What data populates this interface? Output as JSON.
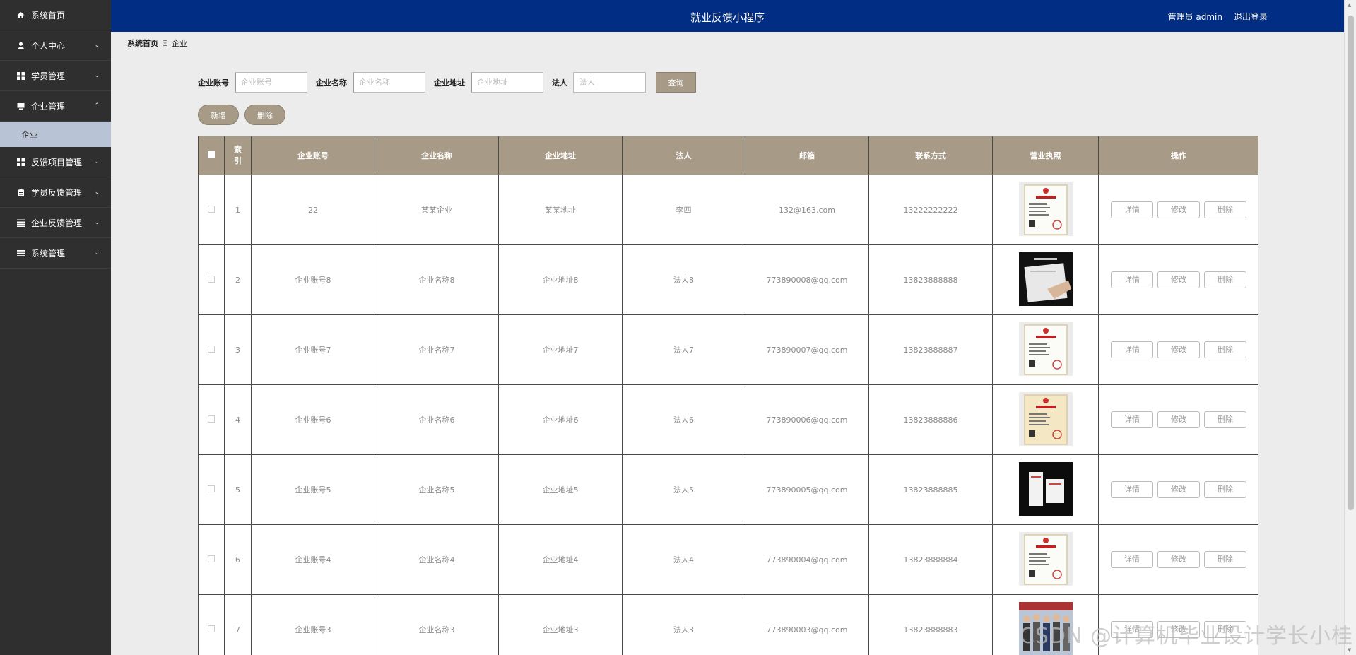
{
  "sidebar": {
    "items": [
      {
        "label": "系统首页",
        "icon": "home-icon",
        "chevron": ""
      },
      {
        "label": "个人中心",
        "icon": "user-icon",
        "chevron": "⌄"
      },
      {
        "label": "学员管理",
        "icon": "grid-icon",
        "chevron": "⌄"
      },
      {
        "label": "企业管理",
        "icon": "monitor-icon",
        "chevron": "⌃"
      },
      {
        "label": "反馈项目管理",
        "icon": "grid-icon",
        "chevron": "⌄"
      },
      {
        "label": "学员反馈管理",
        "icon": "clipboard-icon",
        "chevron": "⌄"
      },
      {
        "label": "企业反馈管理",
        "icon": "list-icon",
        "chevron": "⌄"
      },
      {
        "label": "系统管理",
        "icon": "menu-icon",
        "chevron": "⌄"
      }
    ],
    "sub_item": "企业"
  },
  "header": {
    "title": "就业反馈小程序",
    "admin": "管理员 admin",
    "logout": "退出登录"
  },
  "breadcrumb": {
    "home": "系统首页",
    "sep": "Ξ",
    "current": "企业"
  },
  "search": {
    "fields": [
      {
        "label": "企业账号",
        "placeholder": "企业账号"
      },
      {
        "label": "企业名称",
        "placeholder": "企业名称"
      },
      {
        "label": "企业地址",
        "placeholder": "企业地址"
      },
      {
        "label": "法人",
        "placeholder": "法人"
      }
    ],
    "query_label": "查询"
  },
  "actions": {
    "add_label": "新增",
    "delete_label": "删除"
  },
  "table": {
    "headers": [
      "索引",
      "企业账号",
      "企业名称",
      "企业地址",
      "法人",
      "邮箱",
      "联系方式",
      "营业执照",
      "操作"
    ],
    "ops": [
      "详情",
      "修改",
      "删除"
    ],
    "rows": [
      {
        "index": "1",
        "account": "22",
        "name": "某某企业",
        "address": "某某地址",
        "legal": "李四",
        "email": "132@163.com",
        "phone": "13222222222",
        "license": "certificate-white"
      },
      {
        "index": "2",
        "account": "企业账号8",
        "name": "企业名称8",
        "address": "企业地址8",
        "legal": "法人8",
        "email": "773890008@qq.com",
        "phone": "13823888888",
        "license": "photo-dark"
      },
      {
        "index": "3",
        "account": "企业账号7",
        "name": "企业名称7",
        "address": "企业地址7",
        "legal": "法人7",
        "email": "773890007@qq.com",
        "phone": "13823888887",
        "license": "certificate-white"
      },
      {
        "index": "4",
        "account": "企业账号6",
        "name": "企业名称6",
        "address": "企业地址6",
        "legal": "法人6",
        "email": "773890006@qq.com",
        "phone": "13823888886",
        "license": "certificate-cream"
      },
      {
        "index": "5",
        "account": "企业账号5",
        "name": "企业名称5",
        "address": "企业地址5",
        "legal": "法人5",
        "email": "773890005@qq.com",
        "phone": "13823888885",
        "license": "photo-black"
      },
      {
        "index": "6",
        "account": "企业账号4",
        "name": "企业名称4",
        "address": "企业地址4",
        "legal": "法人4",
        "email": "773890004@qq.com",
        "phone": "13823888884",
        "license": "certificate-white"
      },
      {
        "index": "7",
        "account": "企业账号3",
        "name": "企业名称3",
        "address": "企业地址3",
        "legal": "法人3",
        "email": "773890003@qq.com",
        "phone": "13823888883",
        "license": "photo-group"
      }
    ]
  },
  "watermark": "CSDN @计算机毕业设计学长小桂",
  "colors": {
    "header": "#012d84",
    "sidebar": "#2f2f2f",
    "accent": "#a79b88",
    "sub_active": "#b9c3d6"
  }
}
